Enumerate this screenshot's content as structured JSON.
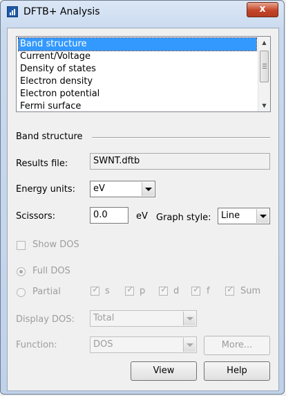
{
  "window": {
    "title": "DFTB+ Analysis",
    "close_label": "x"
  },
  "analysis_list": {
    "items": [
      "Band structure",
      "Current/Voltage",
      "Density of states",
      "Electron density",
      "Electron potential",
      "Fermi surface"
    ],
    "selected": "Band structure"
  },
  "section": {
    "title": "Band structure"
  },
  "results_file": {
    "label": "Results file:",
    "value": "SWNT.dftb"
  },
  "energy_units": {
    "label": "Energy units:",
    "value": "eV"
  },
  "scissors": {
    "label": "Scissors:",
    "value": "0.0",
    "unit": "eV"
  },
  "graph_style": {
    "label": "Graph style:",
    "value": "Line"
  },
  "show_dos": {
    "label": "Show DOS"
  },
  "dos_mode": {
    "full_label": "Full DOS",
    "partial_label": "Partial"
  },
  "orbitals": {
    "s": "s",
    "p": "p",
    "d": "d",
    "f": "f",
    "sum": "Sum"
  },
  "display_dos": {
    "label": "Display DOS:",
    "value": "Total"
  },
  "function": {
    "label": "Function:",
    "value": "DOS",
    "more_label": "More..."
  },
  "buttons": {
    "view": "View",
    "help": "Help"
  }
}
